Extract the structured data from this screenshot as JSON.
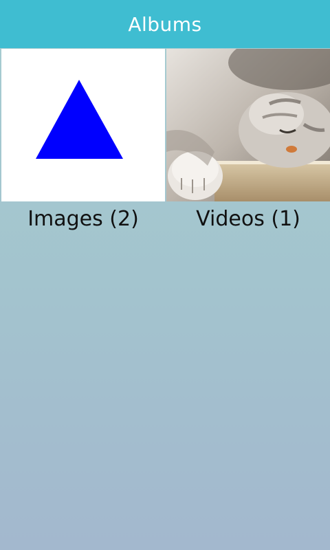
{
  "header": {
    "title": "Albums"
  },
  "albums": [
    {
      "label": "Images (2)",
      "thumbnail": "blue-triangle",
      "thumbnail_color": "#0000ff",
      "background": "#ffffff"
    },
    {
      "label": "Videos (1)",
      "thumbnail": "sleeping-cat-photo"
    }
  ],
  "colors": {
    "header_bg": "#3fbdd1",
    "header_text": "#ffffff",
    "label_text": "#111111",
    "background_top": "#a6cdd1",
    "background_bottom": "#a3b8ce"
  }
}
